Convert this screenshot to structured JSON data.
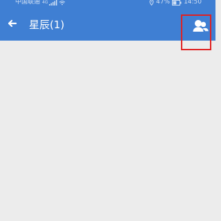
{
  "status_bar": {
    "carrier": "中国联通",
    "network_type": "4G",
    "battery": "47%",
    "time": "14:50"
  },
  "header": {
    "title": "星辰(1)",
    "background_color": "#3f7fd3",
    "back_icon": "arrow-left-icon",
    "contacts_icon": "people-icon"
  },
  "content": {
    "background_color": "#ececec"
  },
  "annotation": {
    "highlight_color": "#e02020"
  }
}
